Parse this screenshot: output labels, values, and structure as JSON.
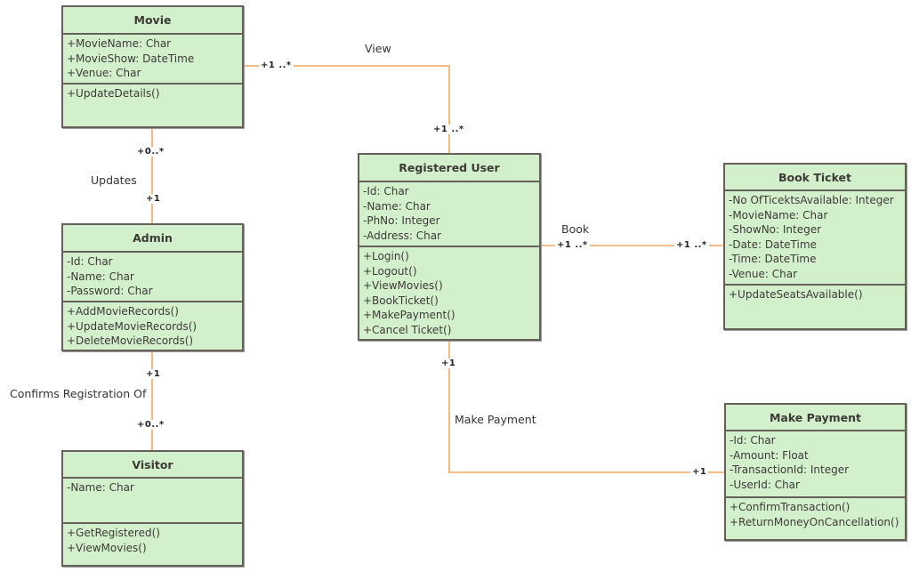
{
  "diagram": {
    "type": "uml-class-diagram",
    "classes": {
      "movie": {
        "name": "Movie",
        "attributes": [
          "+MovieName: Char",
          "+MovieShow: DateTime",
          "+Venue: Char"
        ],
        "methods": [
          "+UpdateDetails()"
        ]
      },
      "admin": {
        "name": "Admin",
        "attributes": [
          "-Id: Char",
          "-Name: Char",
          "-Password: Char"
        ],
        "methods": [
          "+AddMovieRecords()",
          "+UpdateMovieRecords()",
          "+DeleteMovieRecords()"
        ]
      },
      "visitor": {
        "name": "Visitor",
        "attributes": [
          "-Name: Char"
        ],
        "methods": [
          "+GetRegistered()",
          "+ViewMovies()"
        ]
      },
      "registered_user": {
        "name": "Registered User",
        "attributes": [
          "-Id: Char",
          "-Name: Char",
          "-PhNo: Integer",
          "-Address: Char"
        ],
        "methods": [
          "+Login()",
          "+Logout()",
          "+ViewMovies()",
          "+BookTicket()",
          "+MakePayment()",
          "+Cancel Ticket()"
        ]
      },
      "book_ticket": {
        "name": "Book Ticket",
        "attributes": [
          "-No OfTicektsAvailable: Integer",
          "-MovieName: Char",
          "-ShowNo: Integer",
          "-Date: DateTime",
          "-Time: DateTime",
          "-Venue: Char"
        ],
        "methods": [
          "+UpdateSeatsAvailable()"
        ]
      },
      "make_payment": {
        "name": "Make Payment",
        "attributes": [
          "-Id: Char",
          "-Amount: Float",
          "-TransactionId: Integer",
          "-UserId: Char"
        ],
        "methods": [
          "+ConfirmTransaction()",
          "+ReturnMoneyOnCancellation()"
        ]
      }
    },
    "associations": {
      "view": {
        "label": "View",
        "source": "Movie",
        "target": "Registered User",
        "source_mult": "+1 ..*",
        "target_mult": "+1 ..*"
      },
      "updates": {
        "label": "Updates",
        "source": "Movie",
        "target": "Admin",
        "source_mult": "+0..*",
        "target_mult": "+1"
      },
      "confirms": {
        "label": "Confirms Registration Of",
        "source": "Admin",
        "target": "Visitor",
        "source_mult": "+1",
        "target_mult": "+0..*"
      },
      "book": {
        "label": "Book",
        "source": "Registered User",
        "target": "Book Ticket",
        "source_mult": "+1 ..*",
        "target_mult": "+1 ..*"
      },
      "payment": {
        "label": "Make Payment",
        "source": "Registered User",
        "target": "Make Payment",
        "source_mult": "+1",
        "target_mult": "+1"
      }
    },
    "colors": {
      "class_fill": "#d3f0cd",
      "class_border": "#666058",
      "connector": "#f3a65a"
    }
  }
}
